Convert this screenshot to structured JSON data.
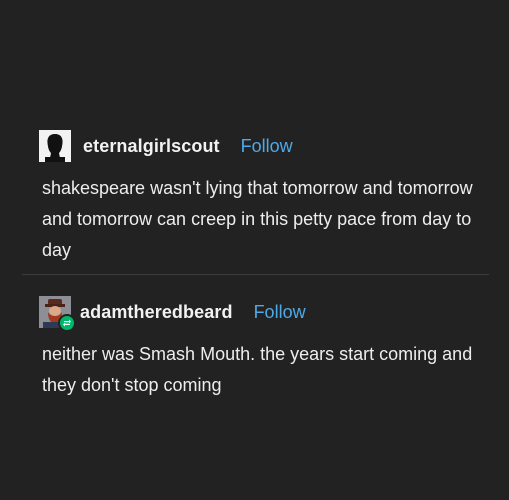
{
  "posts": [
    {
      "username": "eternalgirlscout",
      "follow_label": "Follow",
      "text": "shakespeare wasn't lying that tomorrow and tomorrow and tomorrow can creep in this petty pace from day to day",
      "avatar_icon": "silhouette-avatar-icon"
    },
    {
      "username": "adamtheredbeard",
      "follow_label": "Follow",
      "text": "neither was Smash Mouth. the years start coming and they don't stop coming",
      "avatar_icon": "bearded-man-avatar-icon",
      "badge_icon": "reblog-icon"
    }
  ],
  "colors": {
    "background": "#222222",
    "follow": "#4fa9e8",
    "text": "#ededed",
    "divider": "#3b3b3b",
    "reblog_badge": "#00b86b"
  }
}
